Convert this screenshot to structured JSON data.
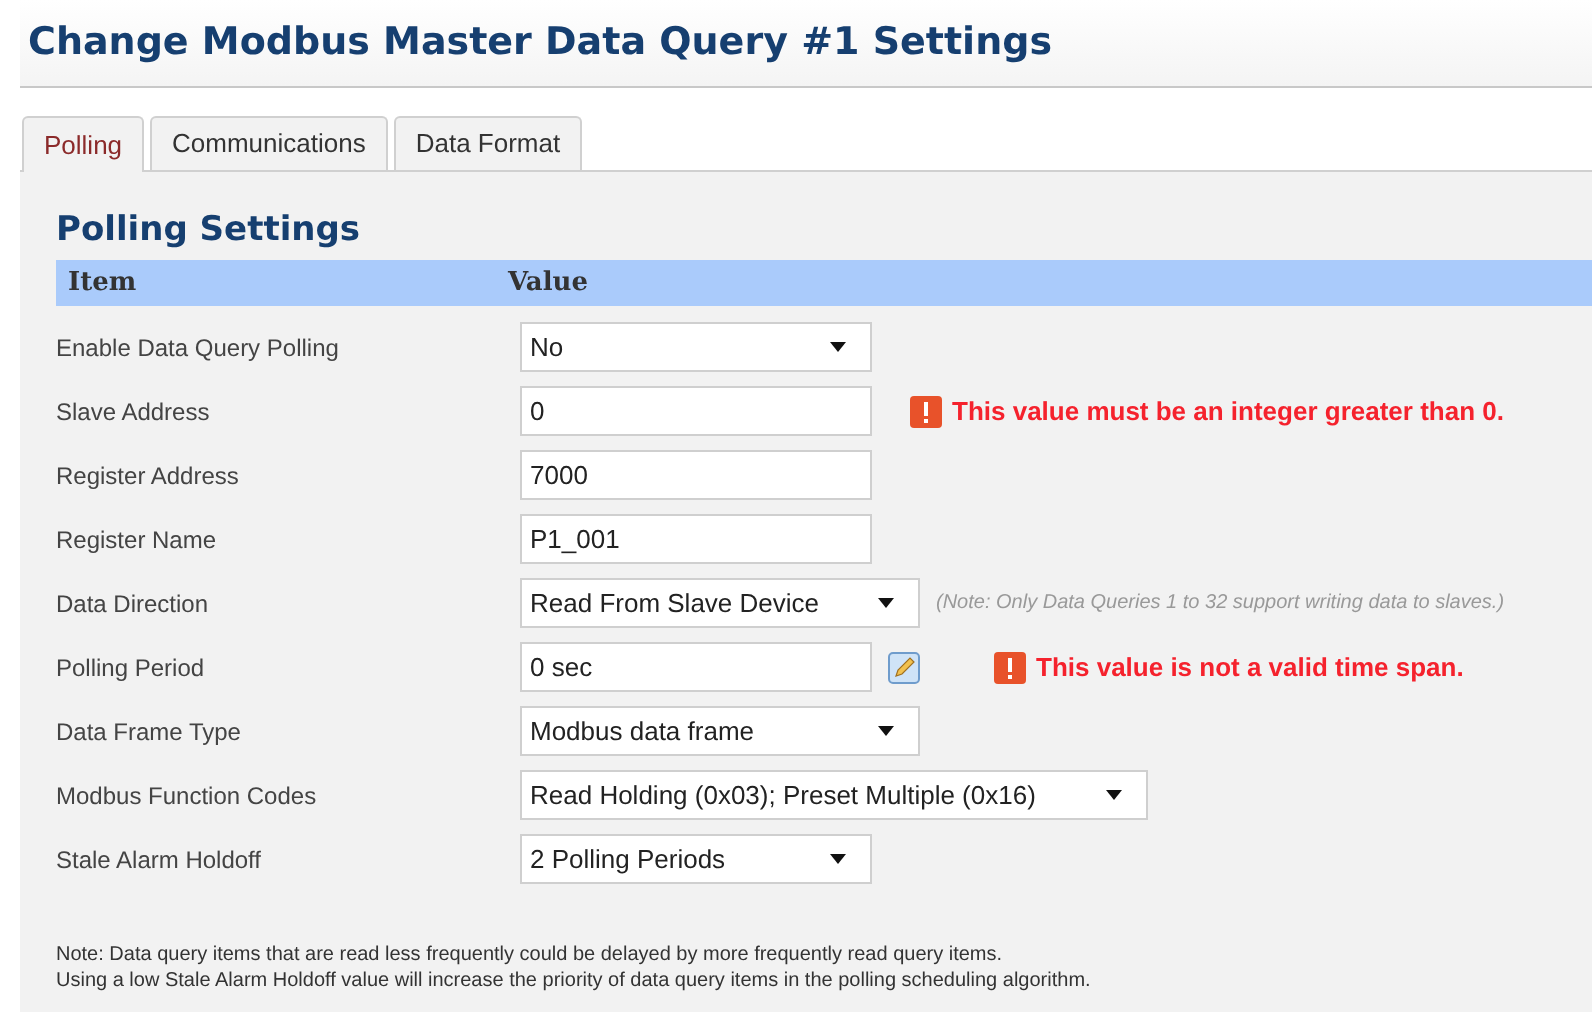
{
  "title": "Change Modbus Master Data Query #1 Settings",
  "tabs": [
    {
      "label": "Polling",
      "selected": true
    },
    {
      "label": "Communications",
      "selected": false
    },
    {
      "label": "Data Format",
      "selected": false
    }
  ],
  "section_title": "Polling Settings",
  "table": {
    "columns": [
      "Item",
      "Value"
    ],
    "rows": [
      {
        "label": "Enable Data Query Polling",
        "kind": "select",
        "value": "No"
      },
      {
        "label": "Slave Address",
        "kind": "text",
        "value": "0",
        "error": "This value must be an integer greater than 0."
      },
      {
        "label": "Register Address",
        "kind": "text",
        "value": "7000"
      },
      {
        "label": "Register Name",
        "kind": "text",
        "value": "P1_001"
      },
      {
        "label": "Data Direction",
        "kind": "select",
        "value": "Read From Slave Device",
        "note": "(Note: Only Data Queries 1 to 32 support writing data to slaves.)"
      },
      {
        "label": "Polling Period",
        "kind": "text",
        "value": "0 sec",
        "editable": true,
        "error": "This value is not a valid time span."
      },
      {
        "label": "Data Frame Type",
        "kind": "select",
        "value": "Modbus data frame"
      },
      {
        "label": "Modbus Function Codes",
        "kind": "select",
        "value": "Read Holding (0x03); Preset Multiple (0x16)"
      },
      {
        "label": "Stale Alarm Holdoff",
        "kind": "select",
        "value": "2 Polling Periods"
      }
    ]
  },
  "notes": [
    "Note: Data query items that are read less frequently could be delayed by more frequently read query items.",
    "Using a low Stale Alarm Holdoff value will increase the priority of data query items in the polling scheduling algorithm."
  ]
}
